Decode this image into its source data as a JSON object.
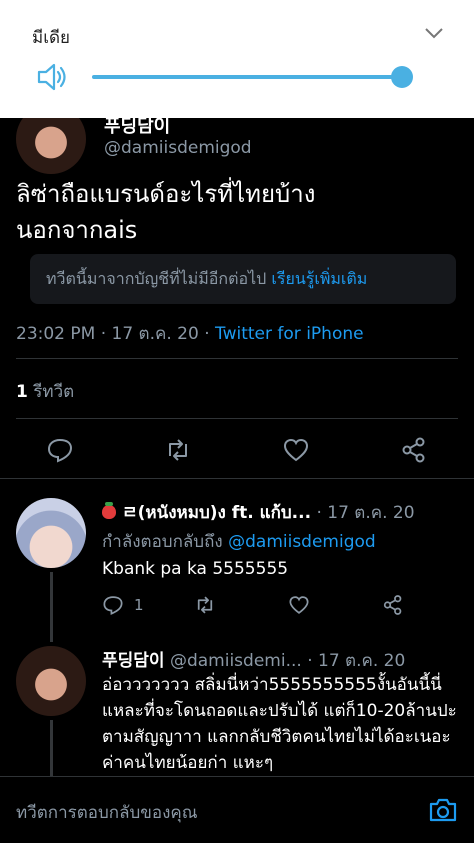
{
  "media_panel": {
    "title": "มีเดีย",
    "volume_level": 0.98,
    "accent_color": "#4ab0e2",
    "icons": [
      "speaker-icon",
      "chevron-down-icon"
    ]
  },
  "main_tweet": {
    "author_name": "푸딩담이",
    "handle": "@damiisdemigod",
    "text_line1": "ลิซ่าถือแบรนด์อะไรที่ไทยบ้าง",
    "text_line2": "นอกจากais",
    "notice_text": "ทวีตนี้มาจากบัญชีที่ไม่มีอีกต่อไป",
    "notice_link": "เรียนรู้เพิ่มเติม",
    "time_date": "23:02 PM · 17 ต.ค. 20 · ",
    "client": "Twitter for iPhone",
    "retweet_count": "1",
    "retweet_label": " รีทวีต",
    "actions": [
      "reply-icon",
      "retweet-icon",
      "like-icon",
      "share-icon"
    ]
  },
  "replies": [
    {
      "name": "ㄹ(หนังหมบ)ง ft. แก้บ...",
      "date": " · 17 ต.ค. 20",
      "replying_label": "กำลังตอบกลับถึง ",
      "replying_mention": "@damiisdemigod",
      "text": "Kbank pa ka 5555555",
      "reply_count": "1"
    },
    {
      "name": "푸딩담이",
      "handle": " @damiisdemi...",
      "date": " · 17 ต.ค. 20",
      "text": "อ่อววววววว สลิ่มนี่หว่า5555555555งั้นอันนี้นี่แหละที่จะโดนถอดและปรับได้ แต่ก็10-20ล้านปะตามสัญญาาา แลกกลับชีวิตคนไทยไม่ได้อะเนอะ ค่าคนไทยน้อยก่า แหะๆ"
    }
  ],
  "compose": {
    "placeholder": "ทวีตการตอบกลับของคุณ"
  },
  "colors": {
    "background": "#000000",
    "link_blue": "#1d9bf0",
    "secondary_text": "#8b98a5"
  }
}
